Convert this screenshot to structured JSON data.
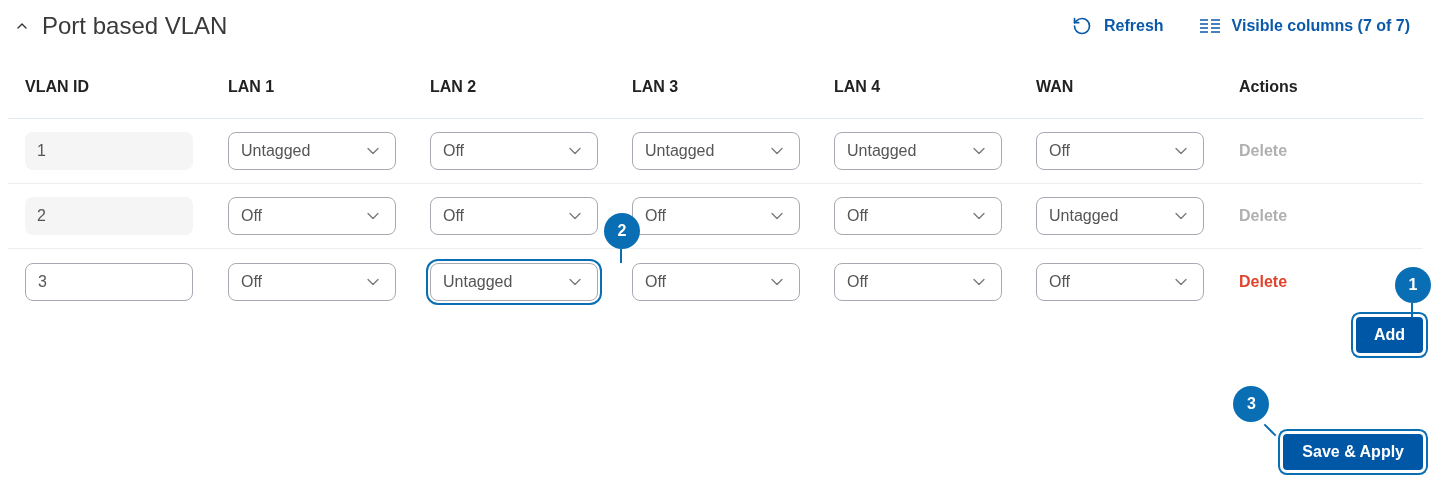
{
  "section": {
    "title": "Port based VLAN",
    "expanded": true
  },
  "toolbar": {
    "refresh": "Refresh",
    "columns": "Visible columns (7 of 7)"
  },
  "table": {
    "columns": [
      "VLAN ID",
      "LAN 1",
      "LAN 2",
      "LAN 3",
      "LAN 4",
      "WAN",
      "Actions"
    ],
    "rows": [
      {
        "vlan_id": {
          "value": "1",
          "disabled": true
        },
        "ports": [
          {
            "value": "Untagged"
          },
          {
            "value": "Off"
          },
          {
            "value": "Untagged"
          },
          {
            "value": "Untagged"
          },
          {
            "value": "Off"
          }
        ],
        "action": {
          "label": "Delete",
          "disabled": true
        }
      },
      {
        "vlan_id": {
          "value": "2",
          "disabled": true
        },
        "ports": [
          {
            "value": "Off"
          },
          {
            "value": "Off"
          },
          {
            "value": "Off"
          },
          {
            "value": "Off"
          },
          {
            "value": "Untagged"
          }
        ],
        "action": {
          "label": "Delete",
          "disabled": true
        }
      },
      {
        "vlan_id": {
          "value": "3",
          "disabled": false
        },
        "ports": [
          {
            "value": "Off"
          },
          {
            "value": "Untagged",
            "callout": "2"
          },
          {
            "value": "Off"
          },
          {
            "value": "Off"
          },
          {
            "value": "Off"
          }
        ],
        "action": {
          "label": "Delete",
          "disabled": false
        }
      }
    ]
  },
  "add_button": {
    "label": "Add",
    "callout": "1"
  },
  "save_button": {
    "label": "Save & Apply",
    "callout": "3"
  }
}
